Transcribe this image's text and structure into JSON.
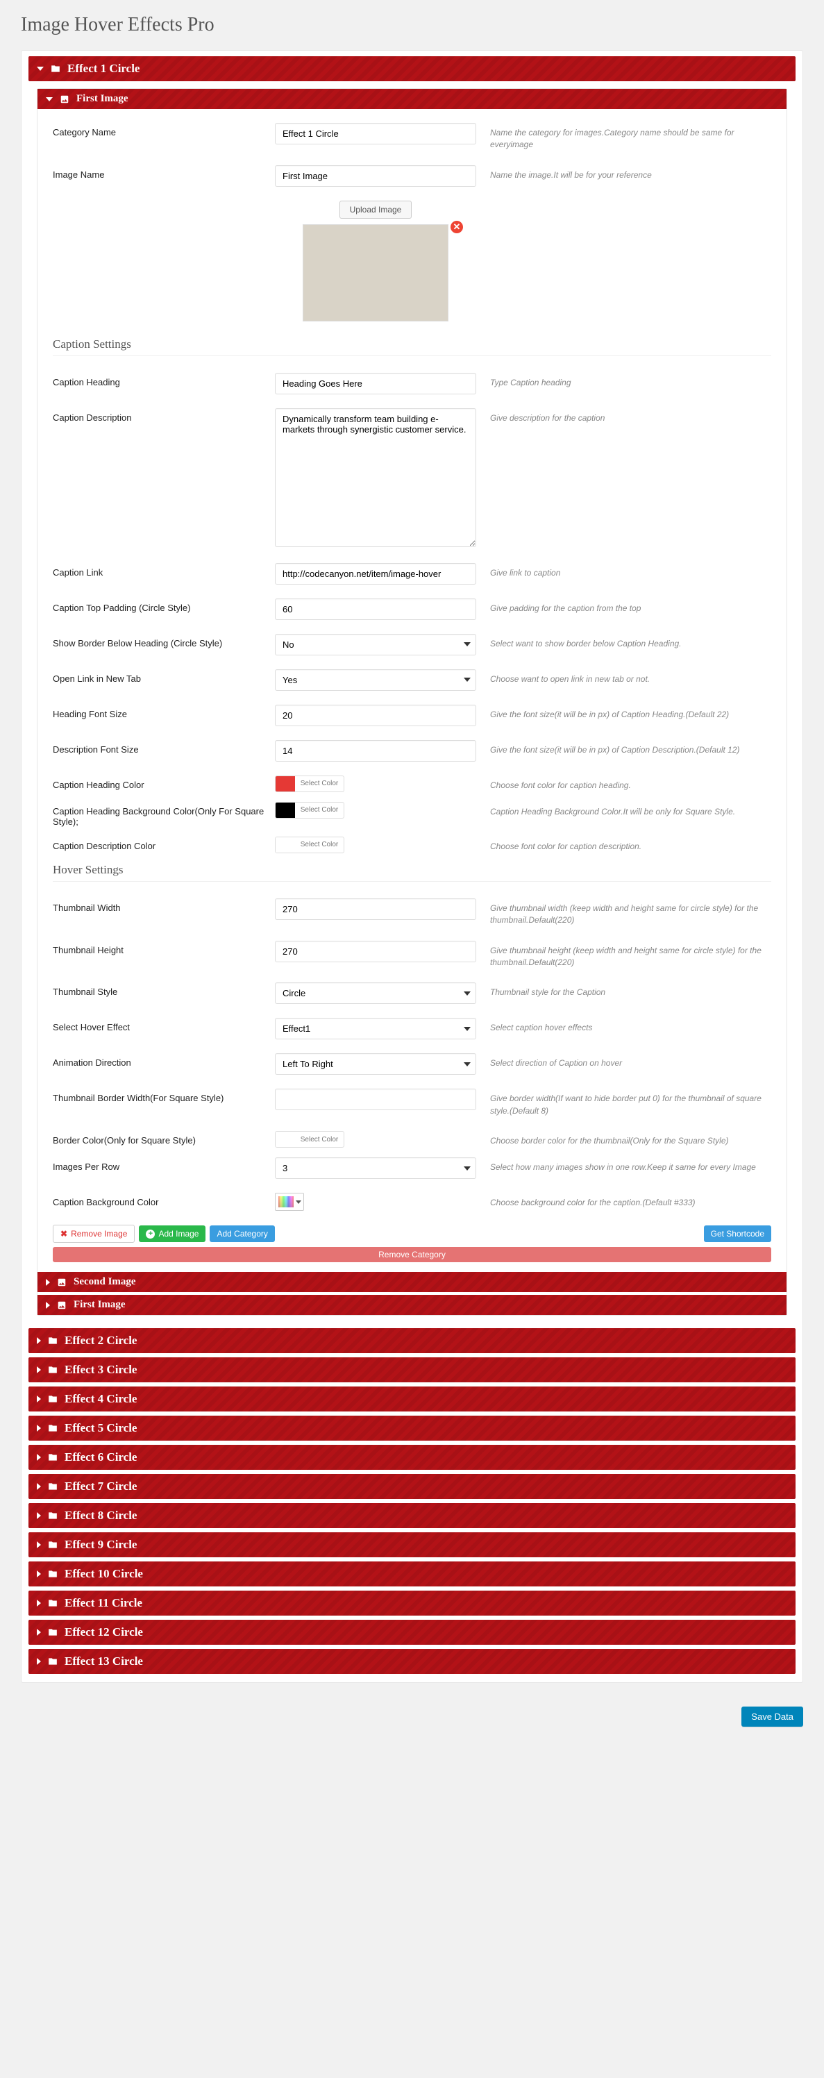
{
  "page_title": "Image Hover Effects Pro",
  "effects": [
    "Effect 1 Circle",
    "Effect 2 Circle",
    "Effect 3 Circle",
    "Effect 4 Circle",
    "Effect 5 Circle",
    "Effect 6 Circle",
    "Effect 7 Circle",
    "Effect 8 Circle",
    "Effect 9 Circle",
    "Effect 10 Circle",
    "Effect 11 Circle",
    "Effect 12 Circle",
    "Effect 13 Circle"
  ],
  "first_image_header": "First Image",
  "second_image_header": "Second Image",
  "extra_first_image_header": "First Image",
  "fields": {
    "category_name": {
      "label": "Category Name",
      "value": "Effect 1 Circle",
      "hint": "Name the category for images.Category name should be same for everyimage"
    },
    "image_name": {
      "label": "Image Name",
      "value": "First Image",
      "hint": "Name the image.It will be for your reference"
    },
    "upload_label": "Upload Image",
    "caption_heading": {
      "label": "Caption Heading",
      "value": "Heading Goes Here",
      "hint": "Type Caption heading"
    },
    "caption_description": {
      "label": "Caption Description",
      "value": "Dynamically transform team building e-markets through synergistic customer service.",
      "hint": "Give description for the caption"
    },
    "caption_link": {
      "label": "Caption Link",
      "value": "http://codecanyon.net/item/image-hover",
      "hint": "Give link to caption"
    },
    "caption_top_padding": {
      "label": "Caption Top Padding (Circle Style)",
      "value": "60",
      "hint": "Give padding for the caption from the top"
    },
    "show_border": {
      "label": "Show Border Below Heading (Circle Style)",
      "value": "No",
      "hint": "Select want to show border below Caption Heading."
    },
    "open_new_tab": {
      "label": "Open Link in New Tab",
      "value": "Yes",
      "hint": "Choose want to open link in new tab or not."
    },
    "heading_font_size": {
      "label": "Heading Font Size",
      "value": "20",
      "hint": "Give the font size(it will be in px) of Caption Heading.(Default 22)"
    },
    "desc_font_size": {
      "label": "Description Font Size",
      "value": "14",
      "hint": "Give the font size(it will be in px) of Caption Description.(Default 12)"
    },
    "caption_heading_color": {
      "label": "Caption Heading Color",
      "swatch": "#e53935",
      "hint": "Choose font color for caption heading."
    },
    "caption_heading_bg": {
      "label": "Caption Heading Background Color(Only For Square Style);",
      "swatch": "#000000",
      "hint": "Caption Heading Background Color.It will be only for Square Style."
    },
    "caption_desc_color": {
      "label": "Caption Description Color",
      "swatch": "#ffffff",
      "hint": "Choose font color for caption description."
    },
    "thumb_width": {
      "label": "Thumbnail Width",
      "value": "270",
      "hint": "Give thumbnail width (keep width and height same for circle style) for the thumbnail.Default(220)"
    },
    "thumb_height": {
      "label": "Thumbnail Height",
      "value": "270",
      "hint": "Give thumbnail height (keep width and height same for circle style) for the thumbnail.Default(220)"
    },
    "thumb_style": {
      "label": "Thumbnail Style",
      "value": "Circle",
      "hint": "Thumbnail style for the Caption"
    },
    "hover_effect": {
      "label": "Select Hover Effect",
      "value": "Effect1",
      "hint": "Select caption hover effects"
    },
    "anim_direction": {
      "label": "Animation Direction",
      "value": "Left To Right",
      "hint": "Select direction of Caption on hover"
    },
    "thumb_border_width": {
      "label": "Thumbnail Border Width(For Square Style)",
      "value": "",
      "hint": "Give border width(If want to hide border put 0) for the thumbnail of square style.(Default 8)"
    },
    "border_color": {
      "label": "Border Color(Only for Square Style)",
      "swatch": "#ffffff",
      "hint": "Choose border color for the thumbnail(Only for the Square Style)"
    },
    "images_per_row": {
      "label": "Images Per Row",
      "value": "3",
      "hint": "Select how many images show in one row.Keep it same for every Image"
    },
    "caption_bg_color": {
      "label": "Caption Background Color",
      "hint": "Choose background color for the caption.(Default #333)"
    }
  },
  "section_caption": "Caption Settings",
  "section_hover": "Hover Settings",
  "select_color_label": "Select Color",
  "buttons": {
    "remove_image": "Remove Image",
    "add_image": "Add Image",
    "add_category": "Add Category",
    "get_shortcode": "Get Shortcode",
    "remove_category": "Remove Category",
    "save": "Save Data"
  }
}
